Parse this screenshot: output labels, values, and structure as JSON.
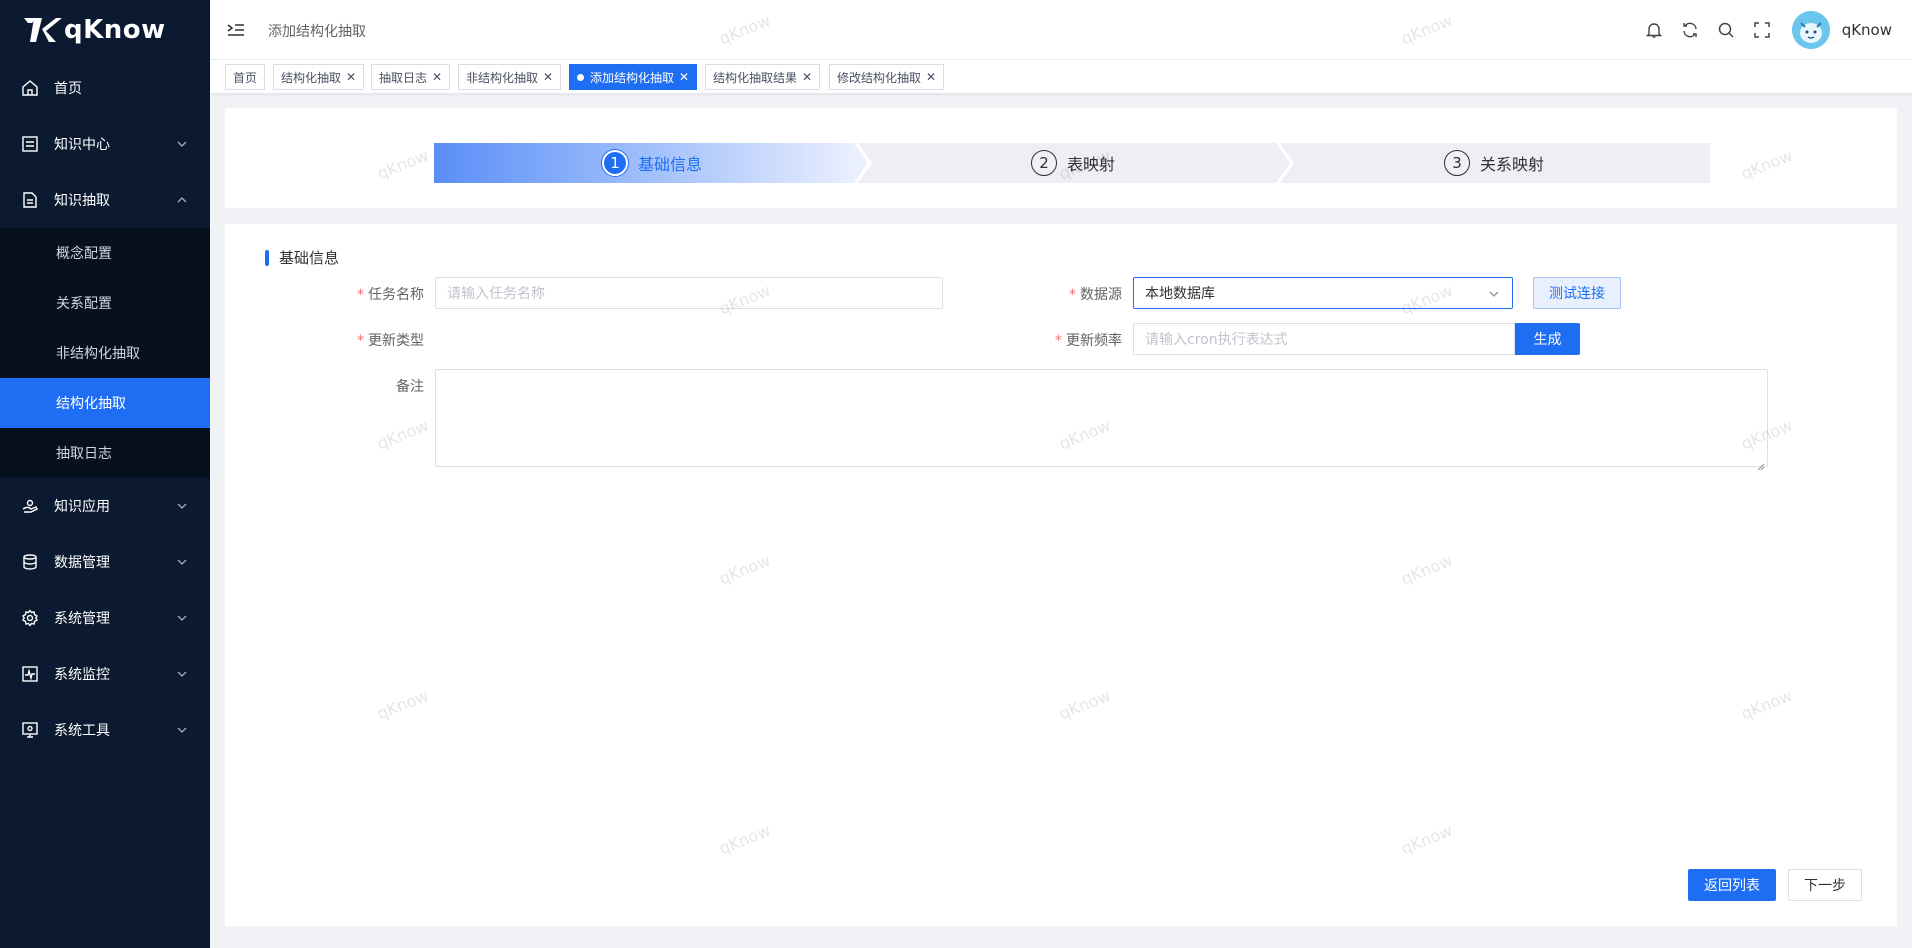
{
  "app": {
    "logo_text": "qKnow"
  },
  "sidebar": {
    "items": [
      {
        "label": "首页",
        "icon": "home-icon"
      },
      {
        "label": "知识中心",
        "icon": "book-icon"
      },
      {
        "label": "知识抽取",
        "icon": "document-icon",
        "expanded": true,
        "children": [
          {
            "label": "概念配置"
          },
          {
            "label": "关系配置"
          },
          {
            "label": "非结构化抽取"
          },
          {
            "label": "结构化抽取",
            "active": true
          },
          {
            "label": "抽取日志"
          }
        ]
      },
      {
        "label": "知识应用",
        "icon": "hand-icon"
      },
      {
        "label": "数据管理",
        "icon": "database-icon"
      },
      {
        "label": "系统管理",
        "icon": "gear-icon"
      },
      {
        "label": "系统监控",
        "icon": "monitor-icon"
      },
      {
        "label": "系统工具",
        "icon": "tool-icon"
      }
    ]
  },
  "header": {
    "breadcrumb": "添加结构化抽取",
    "username": "qKnow",
    "icons": [
      "bell-icon",
      "refresh-icon",
      "search-icon",
      "fullscreen-icon"
    ]
  },
  "tabs": [
    {
      "label": "首页"
    },
    {
      "label": "结构化抽取"
    },
    {
      "label": "抽取日志"
    },
    {
      "label": "非结构化抽取"
    },
    {
      "label": "添加结构化抽取",
      "active": true
    },
    {
      "label": "结构化抽取结果"
    },
    {
      "label": "修改结构化抽取"
    }
  ],
  "steps": [
    {
      "num": "1",
      "label": "基础信息",
      "active": true
    },
    {
      "num": "2",
      "label": "表映射"
    },
    {
      "num": "3",
      "label": "关系映射"
    }
  ],
  "form": {
    "section_title": "基础信息",
    "task_name": {
      "label": "任务名称",
      "placeholder": "请输入任务名称"
    },
    "datasource": {
      "label": "数据源",
      "value": "本地数据库",
      "test_button": "测试连接"
    },
    "update_type": {
      "label": "更新类型"
    },
    "update_freq": {
      "label": "更新频率",
      "placeholder": "请输入cron执行表达式",
      "generate_button": "生成"
    },
    "remark": {
      "label": "备注"
    }
  },
  "footer": {
    "back_button": "返回列表",
    "next_button": "下一步"
  },
  "watermark": "qKnow",
  "colors": {
    "primary": "#1e6ef4",
    "sidebar_bg": "#0b1a30",
    "required": "#f56c6c"
  }
}
